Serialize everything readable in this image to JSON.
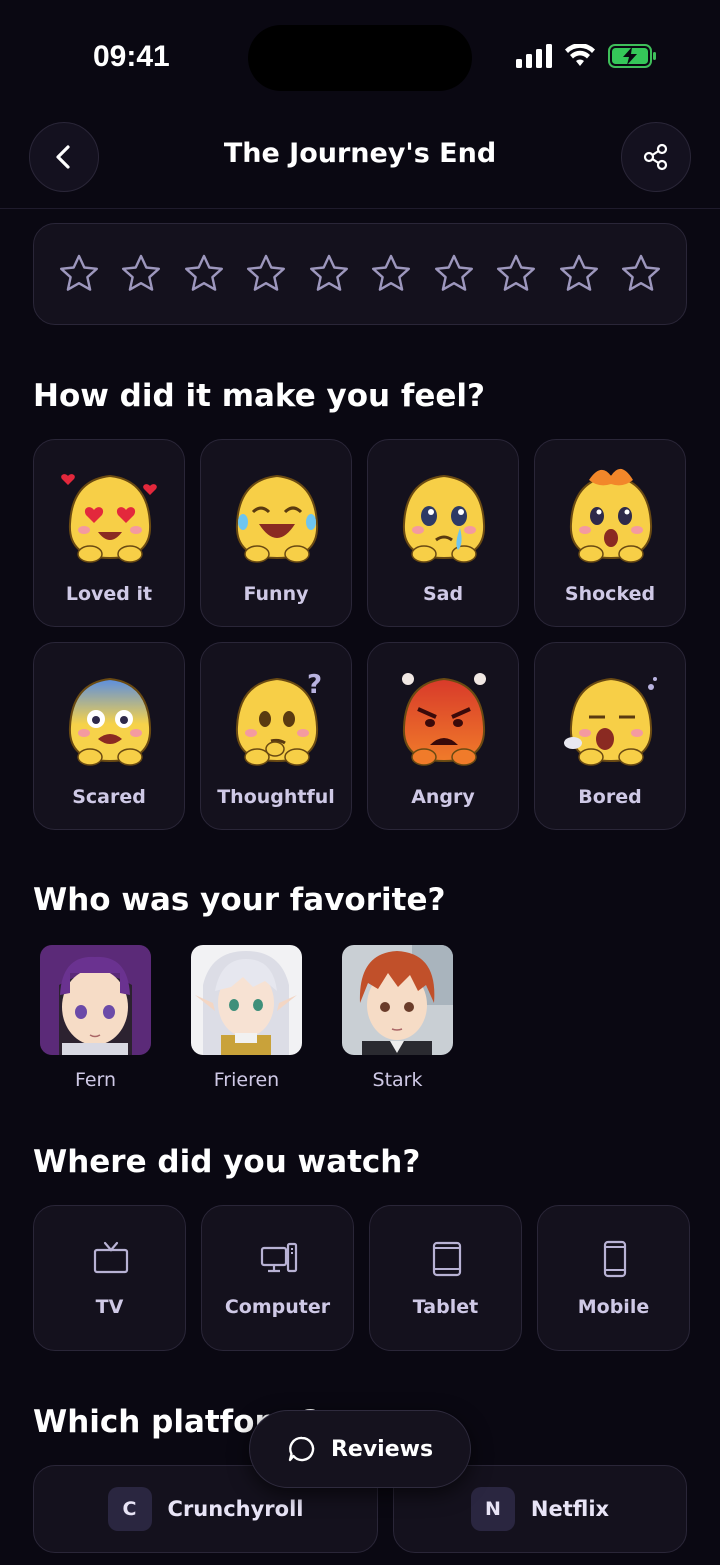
{
  "status_bar": {
    "time": "09:41",
    "icons": [
      "signal-icon",
      "wifi-icon",
      "battery-charging-icon"
    ]
  },
  "header": {
    "title": "The Journey's End",
    "back_icon": "chevron-left-icon",
    "share_icon": "share-icon"
  },
  "rating": {
    "max_stars": 10,
    "selected": 0
  },
  "feelings": {
    "title": "How did it make you feel?",
    "options": [
      {
        "label": "Loved it",
        "icon": "heart-eyes-emoji"
      },
      {
        "label": "Funny",
        "icon": "laughing-emoji"
      },
      {
        "label": "Sad",
        "icon": "crying-emoji"
      },
      {
        "label": "Shocked",
        "icon": "mind-blown-emoji"
      },
      {
        "label": "Scared",
        "icon": "scared-emoji"
      },
      {
        "label": "Thoughtful",
        "icon": "thinking-emoji"
      },
      {
        "label": "Angry",
        "icon": "angry-emoji"
      },
      {
        "label": "Bored",
        "icon": "yawning-emoji"
      }
    ]
  },
  "favorite": {
    "title": "Who was your favorite?",
    "characters": [
      {
        "name": "Fern"
      },
      {
        "name": "Frieren"
      },
      {
        "name": "Stark"
      }
    ]
  },
  "watch": {
    "title": "Where did you watch?",
    "devices": [
      {
        "label": "TV",
        "icon": "tv-icon"
      },
      {
        "label": "Computer",
        "icon": "computer-icon"
      },
      {
        "label": "Tablet",
        "icon": "tablet-icon"
      },
      {
        "label": "Mobile",
        "icon": "mobile-icon"
      }
    ]
  },
  "platforms": {
    "title": "Which platform?",
    "items": [
      {
        "badge": "C",
        "label": "Crunchyroll"
      },
      {
        "badge": "N",
        "label": "Netflix"
      }
    ]
  },
  "reviews_button": {
    "label": "Reviews",
    "icon": "chat-bubble-icon"
  },
  "colors": {
    "background": "#0a0812",
    "card": "#14111d",
    "border": "#2a2638",
    "label": "#cfc9e6",
    "star_outline": "#9d97bd"
  }
}
